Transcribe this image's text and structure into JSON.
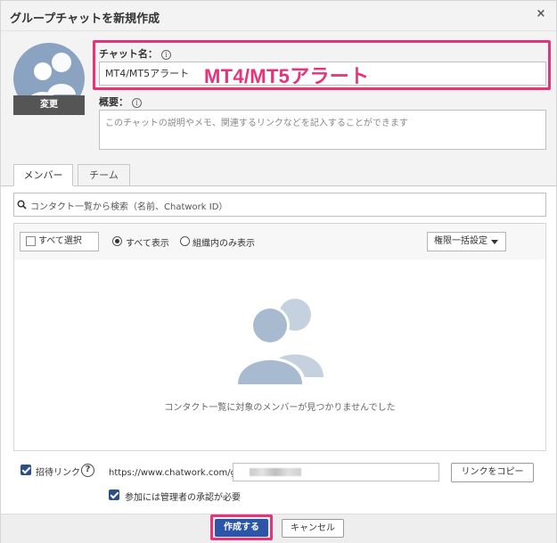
{
  "dialog": {
    "title": "グループチャットを新規作成",
    "close_glyph": "×"
  },
  "avatar": {
    "change_label": "変更"
  },
  "chat_name": {
    "label": "チャット名：",
    "value": "MT4/MT5アラート",
    "annotation": "MT4/MT5アラート"
  },
  "description": {
    "label": "概要：",
    "placeholder": "このチャットの説明やメモ、関連するリンクなどを記入することができます"
  },
  "tabs": [
    {
      "label": "メンバー",
      "active": true
    },
    {
      "label": "チーム",
      "active": false
    }
  ],
  "search": {
    "placeholder": "コンタクト一覧から検索（名前、Chatwork ID）"
  },
  "members": {
    "select_all_label": "すべて選択",
    "filter_options": [
      {
        "label": "すべて表示",
        "selected": true
      },
      {
        "label": "組織内のみ表示",
        "selected": false
      }
    ],
    "permissions_label": "権限一括設定",
    "empty_message": "コンタクト一覧に対象のメンバーが見つかりませんでした"
  },
  "invite": {
    "label": "招待リンク",
    "help_glyph": "?",
    "enabled": true,
    "url_prefix": "https://www.chatwork.com/g/",
    "copy_label": "リンクをコピー",
    "approval_label": "参加には管理者の承認が必要",
    "approval_required": true
  },
  "footer": {
    "create_label": "作成する",
    "cancel_label": "キャンセル"
  },
  "colors": {
    "accent_highlight": "#e8337a",
    "primary_button": "#2b56a8",
    "avatar_bg": "#8aa3c0"
  }
}
